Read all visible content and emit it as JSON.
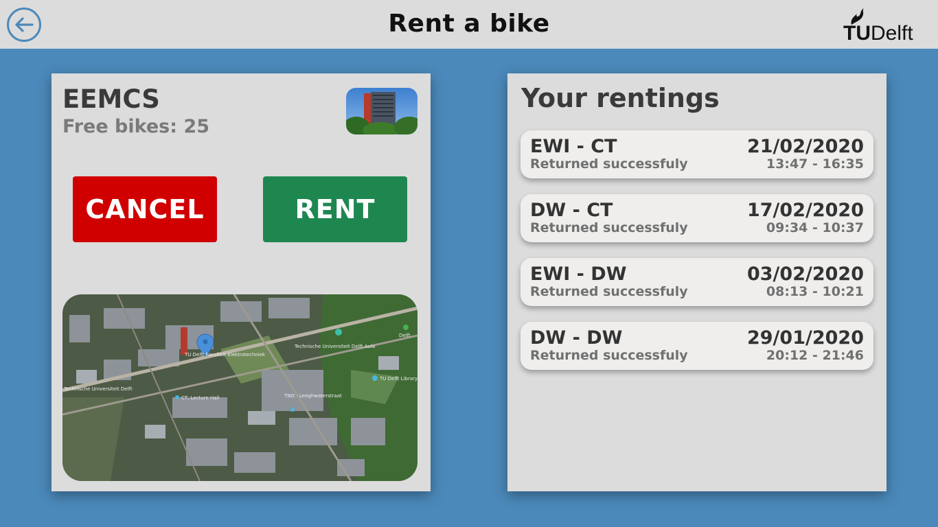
{
  "header": {
    "title": "Rent a bike",
    "back_icon": "arrow-left-circle-icon",
    "logo": {
      "part1": "TU",
      "part2": "Delft",
      "icon": "flame-icon"
    }
  },
  "station": {
    "name": "EEMCS",
    "free_bikes": "Free bikes: 25"
  },
  "actions": {
    "cancel_label": "CANCEL",
    "rent_label": "RENT"
  },
  "map": {
    "labels": [
      "TU Delft Faculteit Elektrotechniek",
      "Technische Universiteit Delft Aula",
      "TU Delft Library",
      "CT, Lecture Hall",
      "TNO - Leeghwaterstraat",
      "Technische Universiteit Delft",
      "Delft"
    ]
  },
  "rentings": {
    "title": "Your rentings",
    "items": [
      {
        "route": "EWI - CT",
        "status": "Returned successfuly",
        "date": "21/02/2020",
        "time": "13:47 - 16:35"
      },
      {
        "route": "DW - CT",
        "status": "Returned successfuly",
        "date": "17/02/2020",
        "time": "09:34 - 10:37"
      },
      {
        "route": "EWI - DW",
        "status": "Returned successfuly",
        "date": "03/02/2020",
        "time": "08:13 - 10:21"
      },
      {
        "route": "DW - DW",
        "status": "Returned successfuly",
        "date": "29/01/2020",
        "time": "20:12 - 21:46"
      }
    ]
  },
  "colors": {
    "background": "#4b89ba",
    "cancel": "#d10000",
    "rent": "#1e8750"
  }
}
